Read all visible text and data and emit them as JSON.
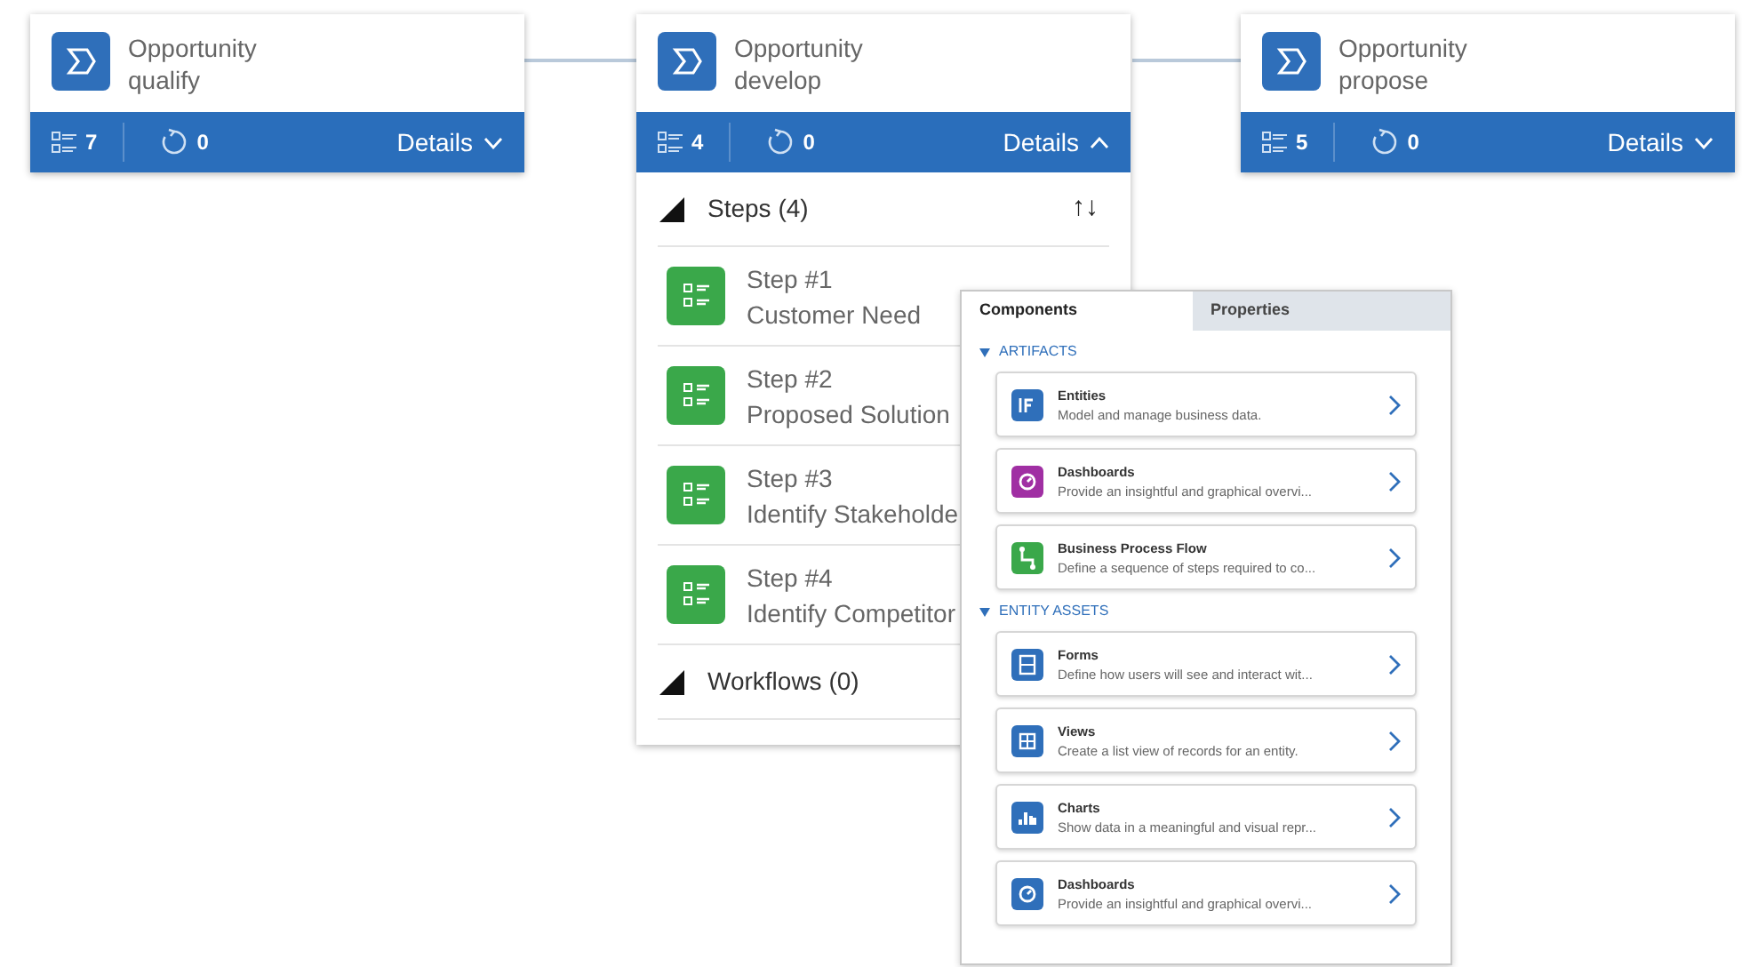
{
  "stages": [
    {
      "title": "Opportunity",
      "subtitle": "qualify",
      "steps_count": "7",
      "workflows_count": "0",
      "details": "Details",
      "expanded": false
    },
    {
      "title": "Opportunity",
      "subtitle": "develop",
      "steps_count": "4",
      "workflows_count": "0",
      "details": "Details",
      "expanded": true,
      "sections": [
        {
          "label": "Steps (4)",
          "expanded": true,
          "sort": "↑↓",
          "items": [
            {
              "number": "Step #1",
              "name": "Customer Need"
            },
            {
              "number": "Step #2",
              "name": "Proposed Solution"
            },
            {
              "number": "Step #3",
              "name": "Identify Stakeholde"
            },
            {
              "number": "Step #4",
              "name": "Identify Competitor"
            }
          ]
        },
        {
          "label": "Workflows (0)",
          "expanded": true
        }
      ]
    },
    {
      "title": "Opportunity",
      "subtitle": "propose",
      "steps_count": "5",
      "workflows_count": "0",
      "details": "Details",
      "expanded": false
    }
  ],
  "panel": {
    "tabs": [
      {
        "label": "Components",
        "selected": true
      },
      {
        "label": "Properties",
        "selected": false
      }
    ],
    "groups": [
      {
        "label": "ARTIFACTS",
        "expanded": true,
        "items": [
          {
            "kind": "entity",
            "color": "#2f6fba",
            "title": "Entities",
            "description": "Model and manage business data."
          },
          {
            "kind": "dashboard",
            "color": "#a02fa3",
            "title": "Dashboards",
            "description": "Provide an insightful and graphical overvi..."
          },
          {
            "kind": "flow",
            "color": "#3aa84a",
            "title": "Business Process Flow",
            "description": "Define a sequence of steps required to co..."
          }
        ]
      },
      {
        "label": "ENTITY ASSETS",
        "expanded": true,
        "items": [
          {
            "kind": "form",
            "color": "#2f6fba",
            "title": "Forms",
            "description": "Define how users will see and interact wit..."
          },
          {
            "kind": "view",
            "color": "#2f6fba",
            "title": "Views",
            "description": "Create a list view of records for an entity."
          },
          {
            "kind": "chart",
            "color": "#2f6fba",
            "title": "Charts",
            "description": "Show data in a meaningful and visual repr..."
          },
          {
            "kind": "dashboard",
            "color": "#2f6fba",
            "title": "Dashboards",
            "description": "Provide an insightful and graphical overvi..."
          }
        ]
      }
    ]
  }
}
